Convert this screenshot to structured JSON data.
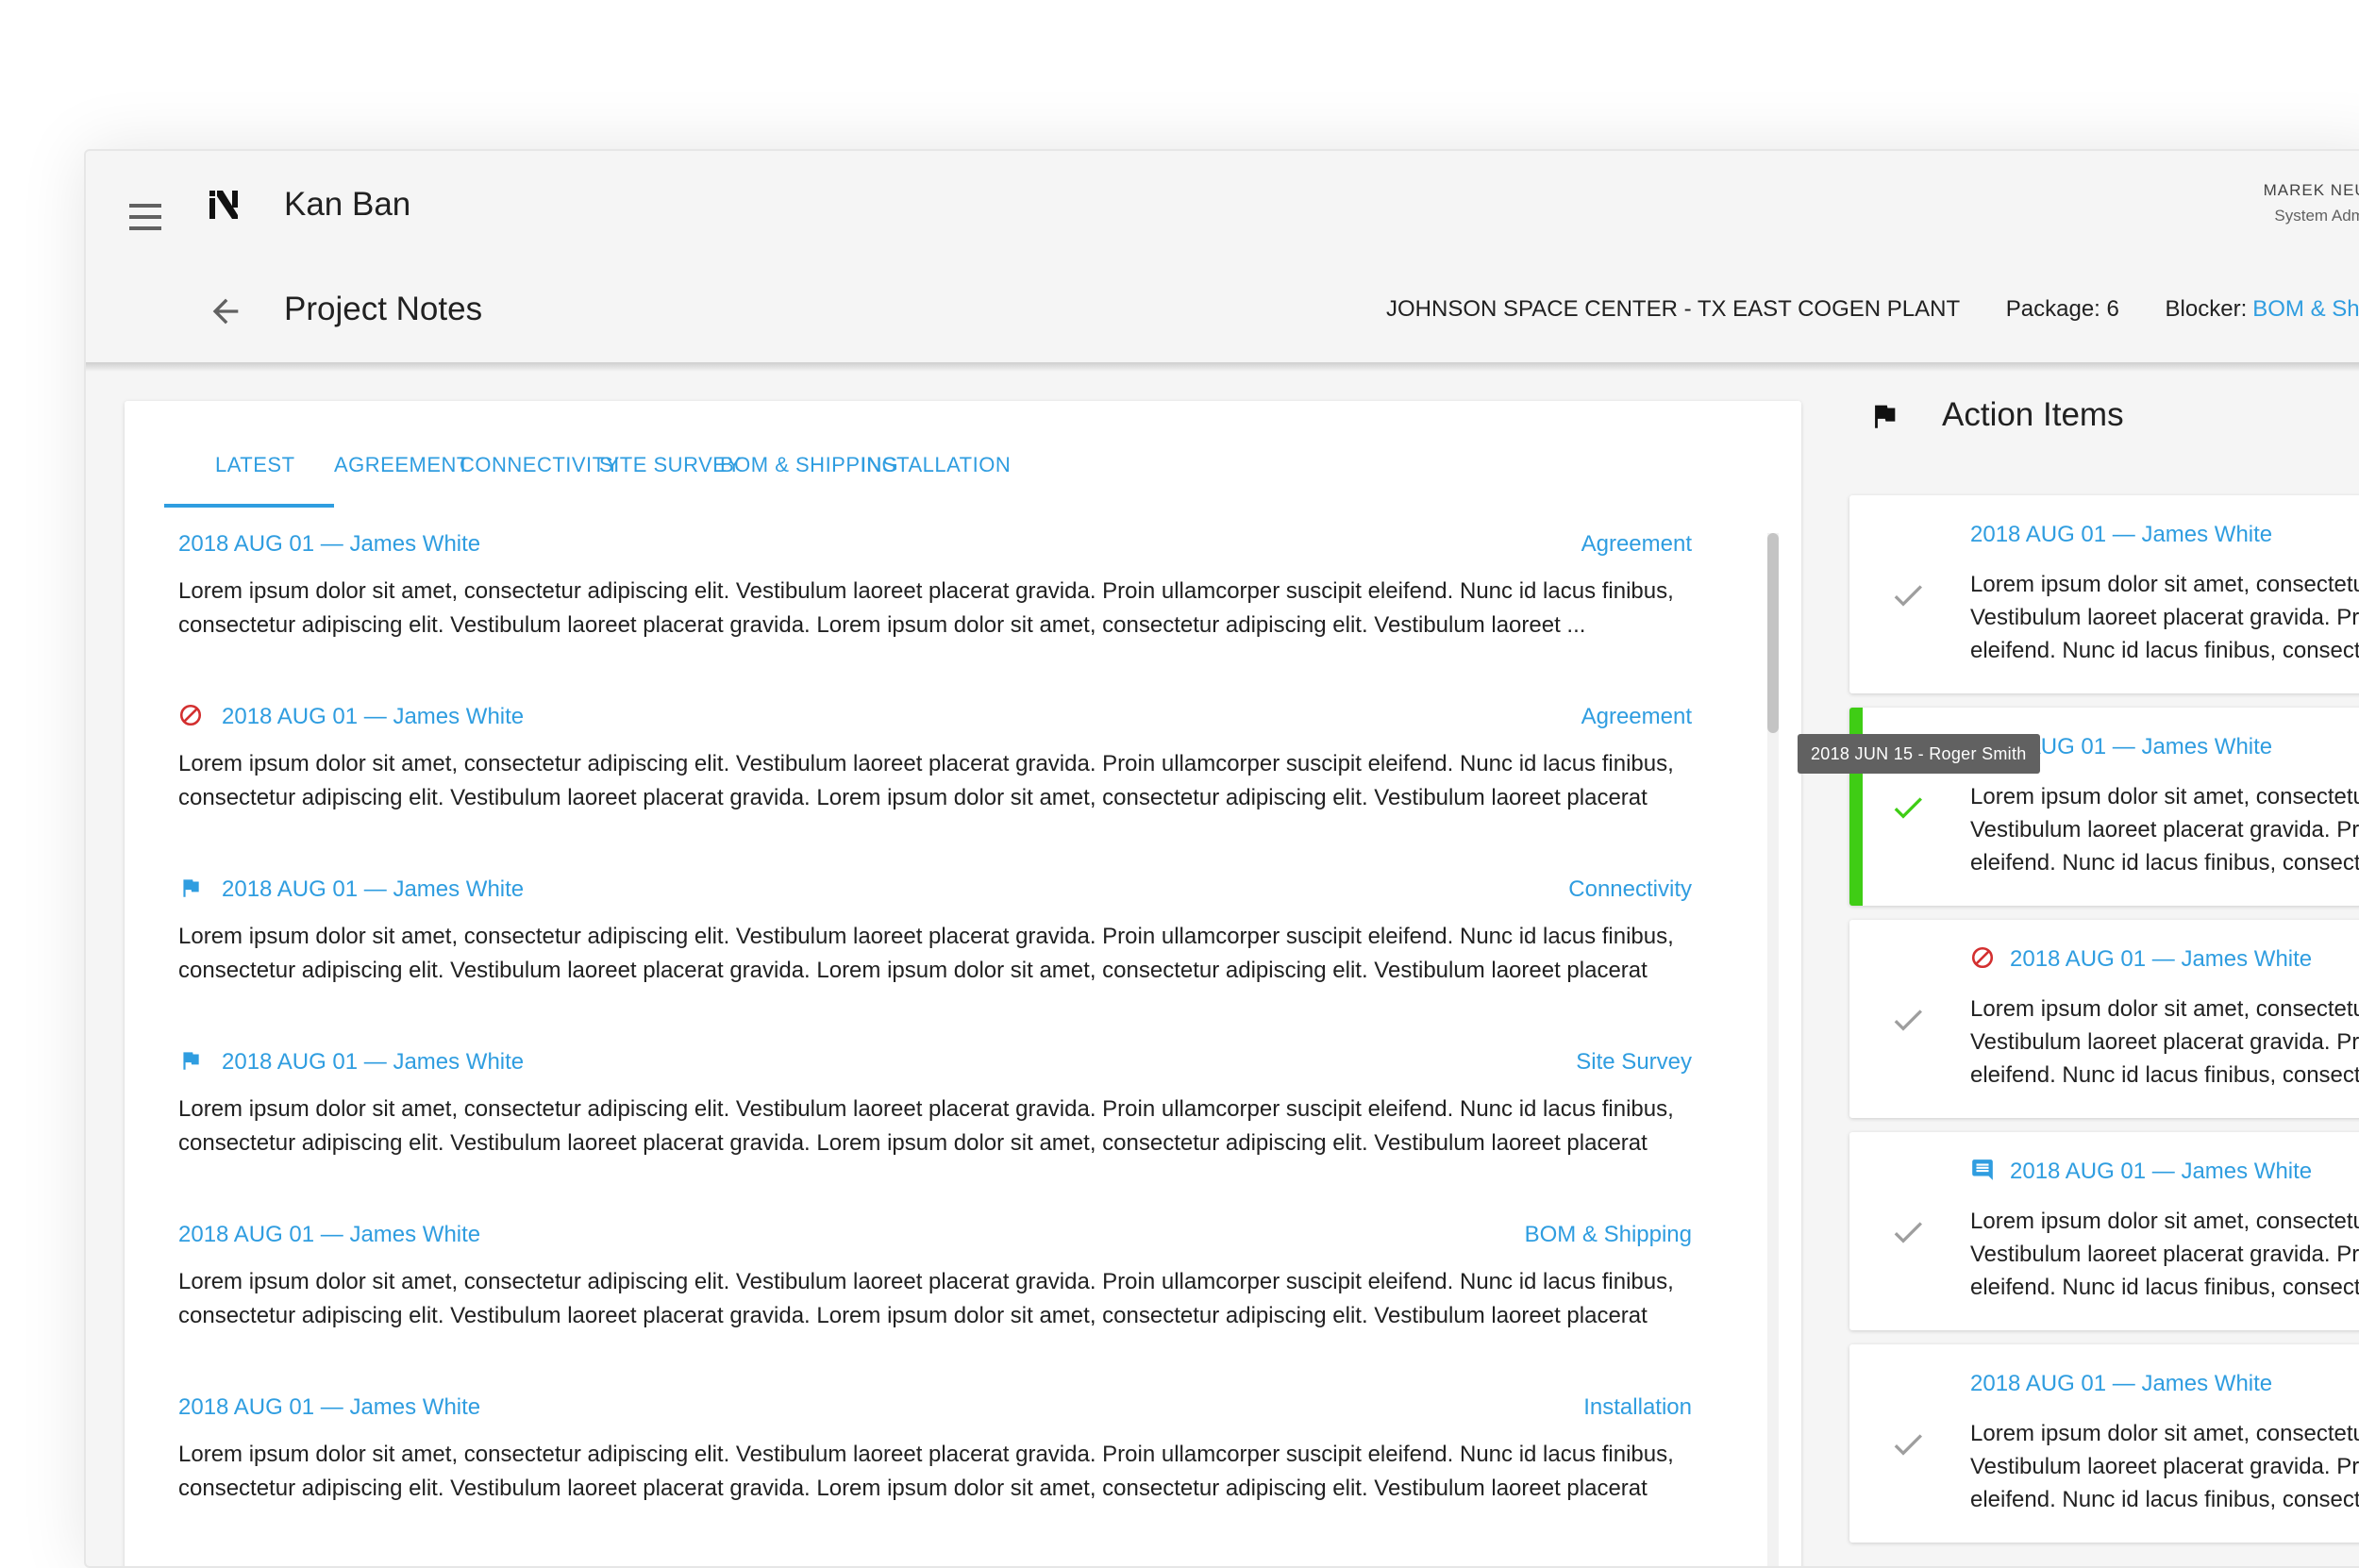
{
  "app": {
    "title": "Kan Ban"
  },
  "user": {
    "name": "MAREK NEUPAUER",
    "role": "System Administrator"
  },
  "page": {
    "title": "Project Notes",
    "site": "JOHNSON SPACE CENTER - TX EAST COGEN PLANT",
    "package": "Package: 6",
    "blocker_label": "Blocker:",
    "blocker_value": "BOM & Shipping"
  },
  "tabs": [
    "LATEST",
    "AGREEMENT",
    "CONNECTIVITY",
    "SITE SURVEY",
    "BOM & SHIPPING",
    "INSTALLATION"
  ],
  "notes": [
    {
      "icon": "none",
      "author": "2018 AUG 01 — James White",
      "category": "Agreement",
      "line1": "Lorem ipsum dolor sit amet, consectetur adipiscing elit. Vestibulum laoreet placerat gravida. Proin ullamcorper suscipit eleifend. Nunc id lacus finibus,",
      "line2": "consectetur adipiscing elit. Vestibulum laoreet placerat gravida. Lorem ipsum dolor sit amet, consectetur adipiscing elit. Vestibulum laoreet ..."
    },
    {
      "icon": "block-icon",
      "author": "2018 AUG 01 — James White",
      "category": "Agreement",
      "line1": "Lorem ipsum dolor sit amet, consectetur adipiscing elit. Vestibulum laoreet placerat gravida. Proin ullamcorper suscipit eleifend. Nunc id lacus finibus,",
      "line2": "consectetur adipiscing elit. Vestibulum laoreet placerat gravida. Lorem ipsum dolor sit amet, consectetur adipiscing elit. Vestibulum laoreet placerat"
    },
    {
      "icon": "flag-icon",
      "author": "2018 AUG 01 — James White",
      "category": "Connectivity",
      "line1": "Lorem ipsum dolor sit amet, consectetur adipiscing elit. Vestibulum laoreet placerat gravida. Proin ullamcorper suscipit eleifend. Nunc id lacus finibus,",
      "line2": "consectetur adipiscing elit. Vestibulum laoreet placerat gravida. Lorem ipsum dolor sit amet, consectetur adipiscing elit. Vestibulum laoreet placerat"
    },
    {
      "icon": "flag-icon",
      "author": "2018 AUG 01 — James White",
      "category": "Site Survey",
      "line1": "Lorem ipsum dolor sit amet, consectetur adipiscing elit. Vestibulum laoreet placerat gravida. Proin ullamcorper suscipit eleifend. Nunc id lacus finibus,",
      "line2": "consectetur adipiscing elit. Vestibulum laoreet placerat gravida. Lorem ipsum dolor sit amet, consectetur adipiscing elit. Vestibulum laoreet placerat"
    },
    {
      "icon": "none",
      "author": "2018 AUG 01 — James White",
      "category": "BOM & Shipping",
      "line1": "Lorem ipsum dolor sit amet, consectetur adipiscing elit. Vestibulum laoreet placerat gravida. Proin ullamcorper suscipit eleifend. Nunc id lacus finibus,",
      "line2": "consectetur adipiscing elit. Vestibulum laoreet placerat gravida. Lorem ipsum dolor sit amet, consectetur adipiscing elit. Vestibulum laoreet placerat"
    },
    {
      "icon": "none",
      "author": "2018 AUG 01 — James White",
      "category": "Installation",
      "line1": "Lorem ipsum dolor sit amet, consectetur adipiscing elit. Vestibulum laoreet placerat gravida. Proin ullamcorper suscipit eleifend. Nunc id lacus finibus,",
      "line2": "consectetur adipiscing elit. Vestibulum laoreet placerat gravida. Lorem ipsum dolor sit amet, consectetur adipiscing elit. Vestibulum laoreet placerat"
    }
  ],
  "action_items": {
    "title": "Action Items",
    "items": [
      {
        "icon": "none",
        "author": "2018 AUG 01 — James White",
        "done": false,
        "line1": "Lorem ipsum dolor sit amet, consectetur",
        "line2": "Vestibulum laoreet placerat gravida. Proin",
        "line3": "eleifend. Nunc id lacus finibus, consectetur"
      },
      {
        "icon": "none",
        "author": "2018 AUG 01 — James White",
        "done": true,
        "line1": "Lorem ipsum dolor sit amet, consectetur",
        "line2": "Vestibulum laoreet placerat gravida. Proin",
        "line3": "eleifend. Nunc id lacus finibus, consectetur"
      },
      {
        "icon": "block-icon",
        "author": "2018 AUG 01 — James White",
        "done": false,
        "line1": "Lorem ipsum dolor sit amet, consectetur",
        "line2": "Vestibulum laoreet placerat gravida. Proin",
        "line3": "eleifend. Nunc id lacus finibus, consectetur"
      },
      {
        "icon": "comment-icon",
        "author": "2018 AUG 01 — James White",
        "done": false,
        "line1": "Lorem ipsum dolor sit amet, consectetur",
        "line2": "Vestibulum laoreet placerat gravida. Proin",
        "line3": "eleifend. Nunc id lacus finibus, consectetur"
      },
      {
        "icon": "none",
        "author": "2018 AUG 01 — James White",
        "done": false,
        "line1": "Lorem ipsum dolor sit amet, consectetur",
        "line2": "Vestibulum laoreet placerat gravida. Proin",
        "line3": "eleifend. Nunc id lacus finibus, consectetur"
      }
    ]
  },
  "tooltip": "2018 JUN 15 - Roger Smith",
  "colors": {
    "accent": "#2f9de0",
    "done": "#3fcd15",
    "blocked": "#d32f2f",
    "appbar": "#f5f5f5"
  }
}
